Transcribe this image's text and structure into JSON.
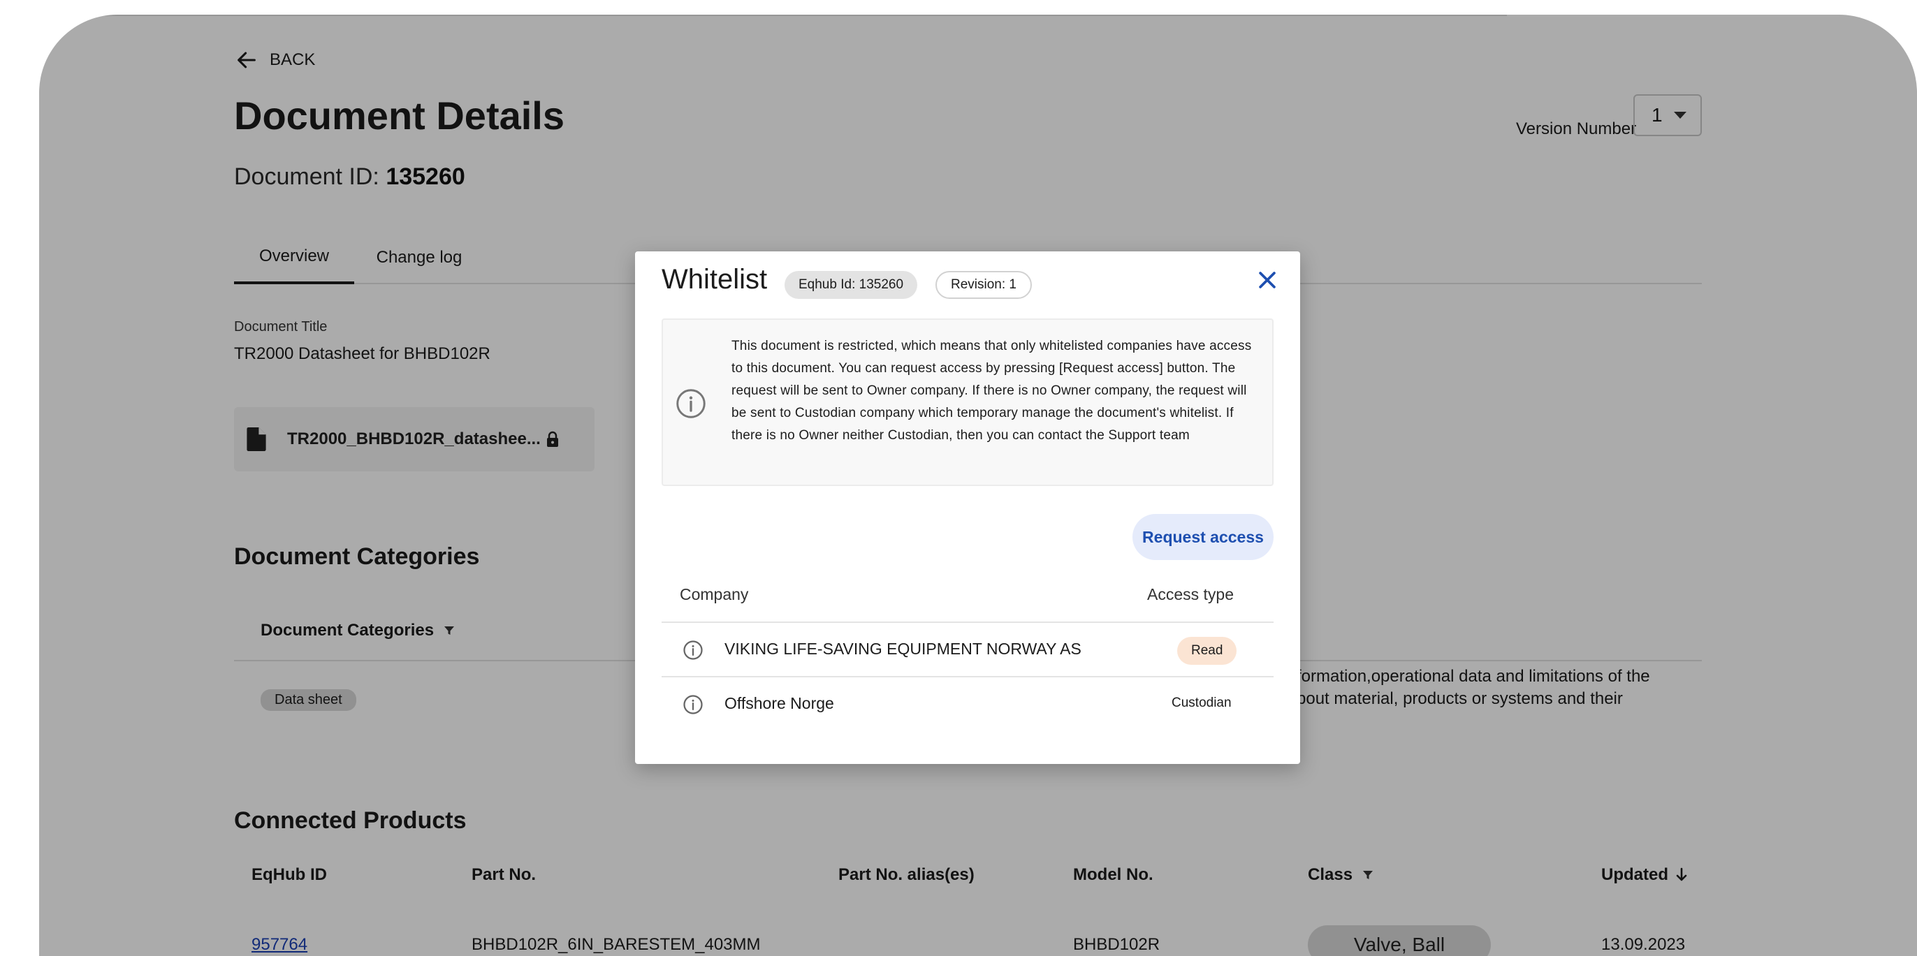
{
  "nav": {
    "back_label": "BACK"
  },
  "page": {
    "title": "Document Details",
    "doc_id_label": "Document ID:",
    "doc_id_value": "135260",
    "version_label": "Version Number",
    "version_value": "1"
  },
  "tabs": [
    {
      "label": "Overview",
      "active": true
    },
    {
      "label": "Change log",
      "active": false
    }
  ],
  "document": {
    "title_label": "Document Title",
    "title_value": "TR2000 Datasheet for BHBD102R",
    "file_name": "TR2000_BHBD102R_datashee..."
  },
  "categories": {
    "section_title": "Document Categories",
    "column_header": "Document Categories",
    "chip": "Data sheet",
    "description_line1": "formation,operational data and limitations of the",
    "description_line2": "bout material, products or systems and their"
  },
  "products": {
    "section_title": "Connected Products",
    "columns": [
      "EqHub ID",
      "Part No.",
      "Part No. alias(es)",
      "Model No.",
      "Class",
      "Updated"
    ],
    "rows": [
      {
        "eqhub_id": "957764",
        "part_no": "BHBD102R_6IN_BARESTEM_403MM",
        "alias": "",
        "model_no": "BHBD102R",
        "class": "Valve, Ball",
        "updated": "13.09.2023"
      }
    ]
  },
  "modal": {
    "title": "Whitelist",
    "eqhub_chip": "Eqhub Id: 135260",
    "revision_chip": "Revision: 1",
    "info_text": "This document is restricted, which means that only whitelisted companies have access to this document. You can request access by pressing [Request access] button. The request will be sent to Owner company. If there is no Owner company, the request will be sent to Custodian company which temporary manage the document's whitelist. If there is no Owner neither Custodian, then you can contact the Support team",
    "request_button": "Request access",
    "col_company": "Company",
    "col_access": "Access type",
    "rows": [
      {
        "company": "VIKING LIFE-SAVING EQUIPMENT NORWAY AS",
        "access": "Read"
      },
      {
        "company": "Offshore Norge",
        "access": "Custodian"
      }
    ]
  },
  "colors": {
    "accent_blue": "#1e4fb0",
    "request_bg": "#e5ebfb",
    "read_badge_bg": "#fbe4d3",
    "scrim": "rgba(0,0,0,0.33)"
  }
}
